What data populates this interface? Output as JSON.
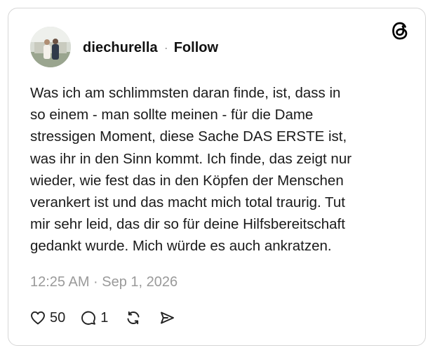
{
  "post": {
    "username": "diechurella",
    "separator": "·",
    "follow_label": "Follow",
    "text_lines": [
      "Was ich am schlimmsten daran finde, ist, dass in",
      "so einem - man sollte meinen - für die Dame",
      "stressigen Moment, diese Sache DAS ERSTE ist,",
      "was ihr in den Sinn kommt. Ich finde, das zeigt nur",
      "wieder, wie fest das in den Köpfen der Menschen",
      "verankert ist und das macht mich total traurig. Tut",
      "mir sehr leid, das dir so für deine Hilfsbereitschaft",
      "gedankt wurde. Mich würde es auch ankratzen."
    ],
    "timestamp": "12:25 AM · Sep 1, 2026",
    "like_count": "50",
    "reply_count": "1"
  },
  "icons": {
    "logo": "threads-logo-icon",
    "like": "heart-icon",
    "reply": "comment-bubble-icon",
    "repost": "repost-icon",
    "share": "send-icon"
  },
  "colors": {
    "text": "#111111",
    "muted": "#9a9a9a",
    "border": "#d6d6d6"
  }
}
